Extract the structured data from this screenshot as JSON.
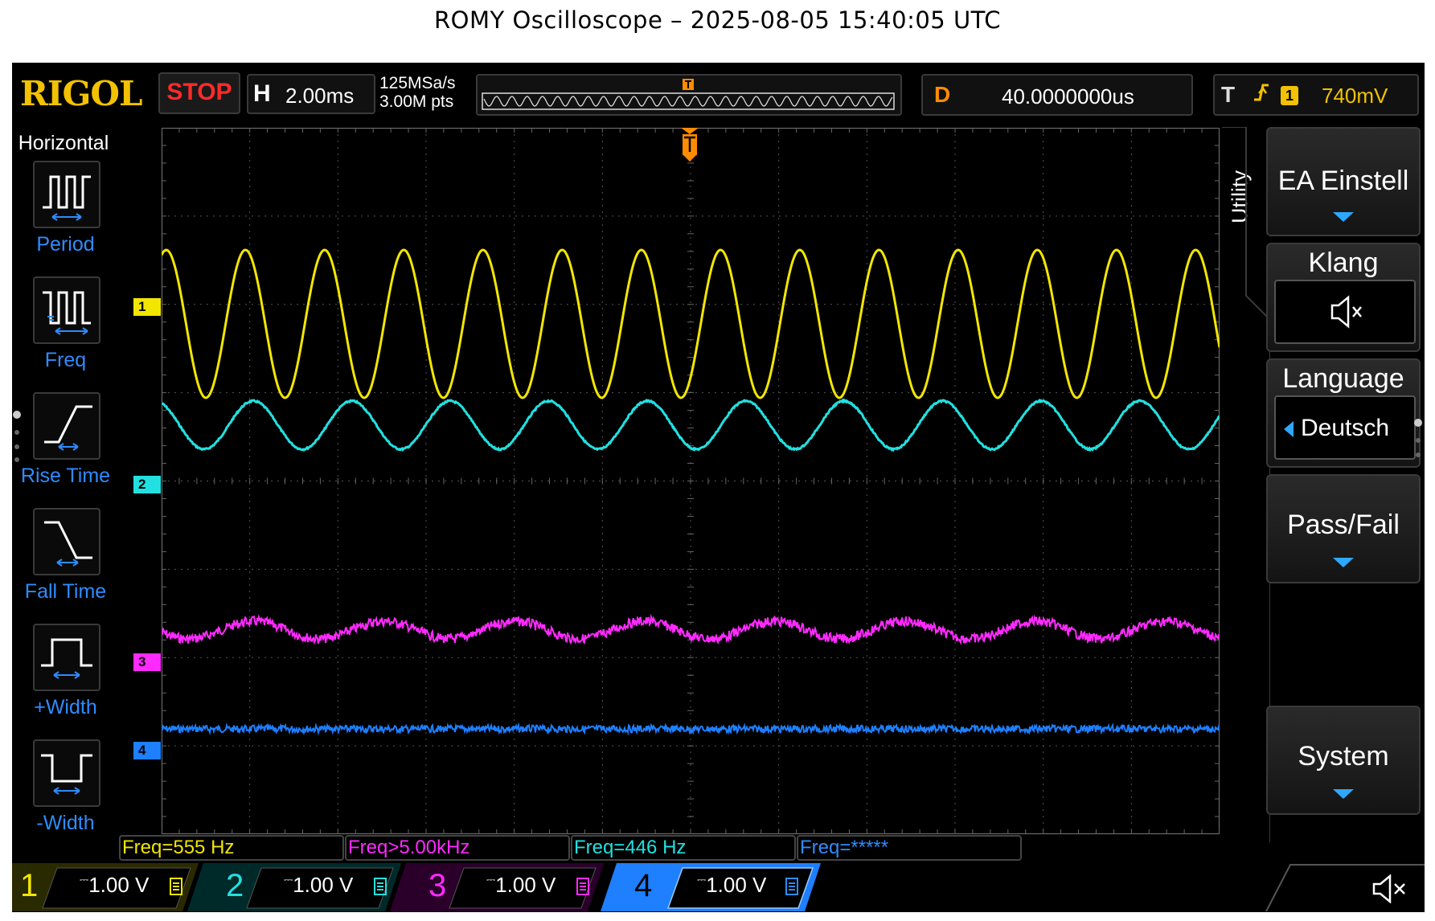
{
  "page_title": "ROMY Oscilloscope – 2025-08-05 15:40:05 UTC",
  "topbar": {
    "brand": "RIGOL",
    "run_state": "STOP",
    "horizontal": {
      "letter": "H",
      "timebase": "2.00ms"
    },
    "sample_rate": "125MSa/s",
    "memory_depth": "3.00M pts",
    "delay": {
      "letter": "D",
      "value": "40.0000000us"
    },
    "trigger": {
      "letter": "T",
      "source": "1",
      "level": "740mV",
      "edge_icon": "rising-edge-icon"
    }
  },
  "left_menu": {
    "title": "Horizontal",
    "items": [
      {
        "label": "Period",
        "icon": "period-icon"
      },
      {
        "label": "Freq",
        "icon": "freq-icon"
      },
      {
        "label": "Rise Time",
        "icon": "rise-time-icon"
      },
      {
        "label": "Fall Time",
        "icon": "fall-time-icon"
      },
      {
        "label": "+Width",
        "icon": "positive-width-icon"
      },
      {
        "label": "-Width",
        "icon": "negative-width-icon"
      }
    ]
  },
  "right_menu": {
    "section_label": "Utility",
    "buttons": [
      {
        "label": "EA Einstell"
      },
      {
        "label": "Klang",
        "value_icon": "speaker-muted-icon"
      },
      {
        "label": "Language",
        "value": "Deutsch"
      },
      {
        "label": "Pass/Fail"
      },
      {
        "label": "System"
      }
    ]
  },
  "measurements": [
    {
      "text": "Freq=555 Hz",
      "color": "#f2e600"
    },
    {
      "text": "Freq>5.00kHz",
      "color": "#ff2aff"
    },
    {
      "text": "Freq=446 Hz",
      "color": "#22e0e0"
    },
    {
      "text": "Freq=*****",
      "color": "#2e8cff"
    }
  ],
  "channels": [
    {
      "number": "1",
      "scale": "1.00 V",
      "color": "#f2e600"
    },
    {
      "number": "2",
      "scale": "1.00 V",
      "color": "#22e0e0"
    },
    {
      "number": "3",
      "scale": "1.00 V",
      "color": "#ff2aff"
    },
    {
      "number": "4",
      "scale": "1.00 V",
      "color": "#1e7fff"
    }
  ],
  "channel_markers": [
    "1",
    "2",
    "3",
    "4"
  ],
  "trigger_marker": "T",
  "status_icon": "speaker-muted-icon",
  "colors": {
    "accent": "#2e8cff",
    "trigger": "#ff8c00",
    "grid": "#555555"
  }
}
